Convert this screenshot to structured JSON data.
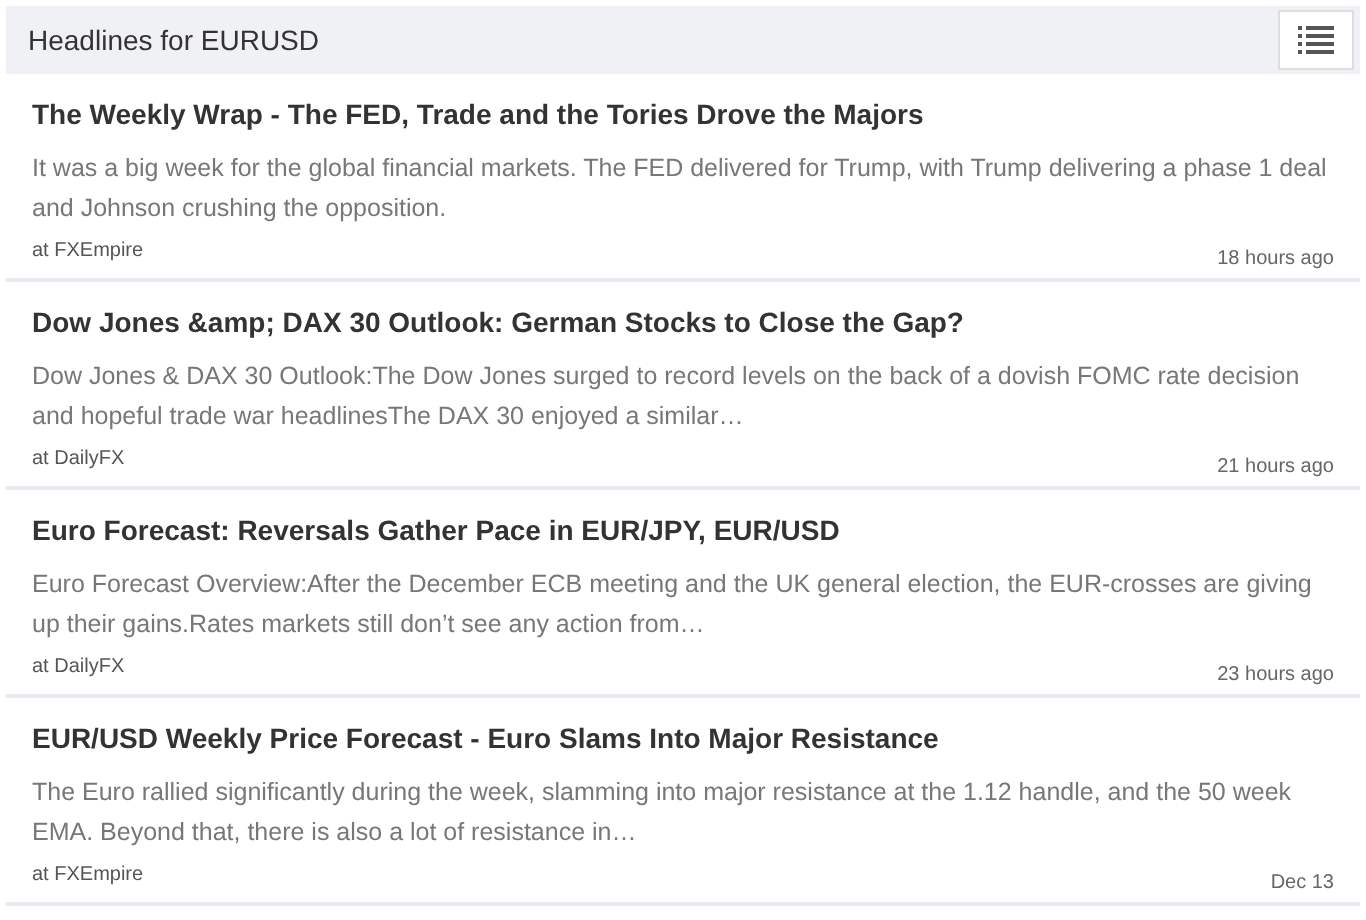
{
  "header": {
    "title": "Headlines for EURUSD"
  },
  "headlines": [
    {
      "title": "The Weekly Wrap - The FED, Trade and the Tories Drove the Majors",
      "summary": "It was a big week for the global financial markets. The FED delivered for Trump, with Trump delivering a phase 1 deal and Johnson crushing the opposition.",
      "source": "at FXEmpire",
      "time": "18 hours ago"
    },
    {
      "title": "Dow Jones &amp; DAX 30 Outlook: German Stocks to Close the Gap?",
      "summary": "Dow Jones & DAX 30 Outlook:The Dow Jones surged to record levels on the back of a dovish FOMC rate decision and hopeful trade war headlinesThe DAX 30 enjoyed a similar…",
      "source": "at DailyFX",
      "time": "21 hours ago"
    },
    {
      "title": "Euro Forecast: Reversals Gather Pace in EUR/JPY, EUR/USD",
      "summary": "Euro Forecast Overview:After the December ECB meeting and the UK general election, the EUR-crosses are giving up their gains.Rates markets still don’t see any action from…",
      "source": "at DailyFX",
      "time": "23 hours ago"
    },
    {
      "title": "EUR/USD Weekly Price Forecast - Euro Slams Into Major Resistance",
      "summary": "The Euro rallied significantly during the week, slamming into major resistance at the 1.12 handle, and the 50 week EMA. Beyond that, there is also a lot of resistance in…",
      "source": "at FXEmpire",
      "time": "Dec 13"
    }
  ]
}
